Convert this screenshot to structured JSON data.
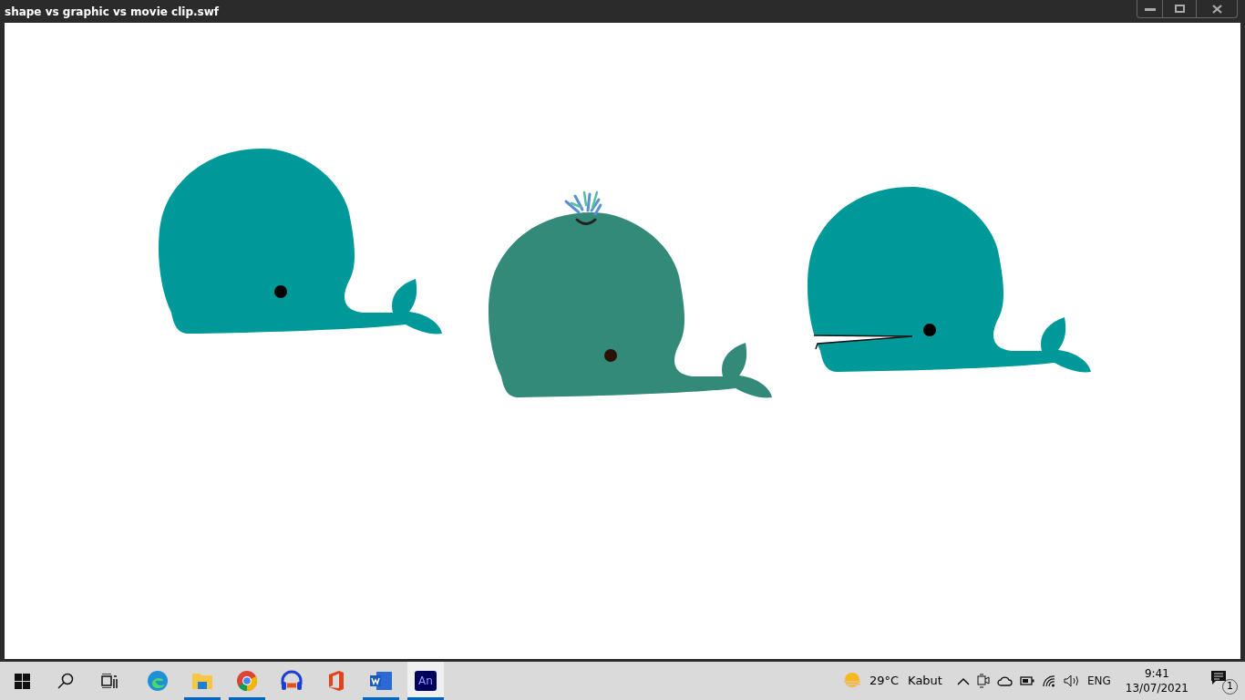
{
  "window": {
    "title": "shape vs graphic vs movie clip.swf"
  },
  "stage": {
    "whales": [
      {
        "kind": "plain",
        "color": "#009999"
      },
      {
        "kind": "spout",
        "color": "#348a79"
      },
      {
        "kind": "mouth",
        "color": "#009999"
      }
    ]
  },
  "taskbar": {
    "apps": [
      {
        "running": false,
        "selected": false
      },
      {
        "running": true,
        "selected": false
      },
      {
        "running": true,
        "selected": false
      },
      {
        "running": false,
        "selected": false
      },
      {
        "running": false,
        "selected": false
      },
      {
        "running": true,
        "selected": false
      },
      {
        "running": true,
        "selected": true,
        "logo_text": "An"
      }
    ],
    "weather": {
      "temperature": "29°C",
      "condition": "Kabut"
    },
    "language": "ENG",
    "time": "9:41",
    "date": "13/07/2021",
    "notifications": "1"
  }
}
